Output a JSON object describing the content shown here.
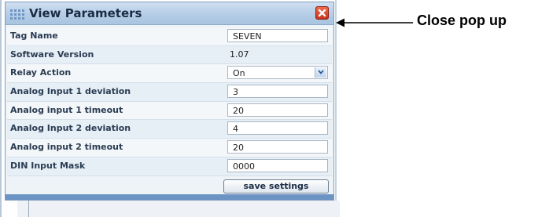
{
  "dialog": {
    "title": "View Parameters",
    "icons": {
      "title": "grid-icon",
      "close": "close-icon",
      "dropdown": "chevron-down-icon"
    },
    "rows": [
      {
        "label": "Tag Name",
        "value": "SEVEN",
        "kind": "input"
      },
      {
        "label": "Software Version",
        "value": "1.07",
        "kind": "readonly"
      },
      {
        "label": "Relay Action",
        "value": "On",
        "kind": "select"
      },
      {
        "label": "Analog Input 1 deviation",
        "value": "3",
        "kind": "input"
      },
      {
        "label": "Analog input 1 timeout",
        "value": "20",
        "kind": "input"
      },
      {
        "label": "Analog Input 2 deviation",
        "value": "4",
        "kind": "input"
      },
      {
        "label": "Analog input 2 timeout",
        "value": "20",
        "kind": "input"
      },
      {
        "label": "DIN Input Mask",
        "value": "0000",
        "kind": "input"
      }
    ],
    "save_label": "save settings"
  },
  "annotation": {
    "text": "Close pop up"
  },
  "colors": {
    "accent": "#6b93c4",
    "close": "#d9432b",
    "title_bar": "#b5cde6"
  }
}
